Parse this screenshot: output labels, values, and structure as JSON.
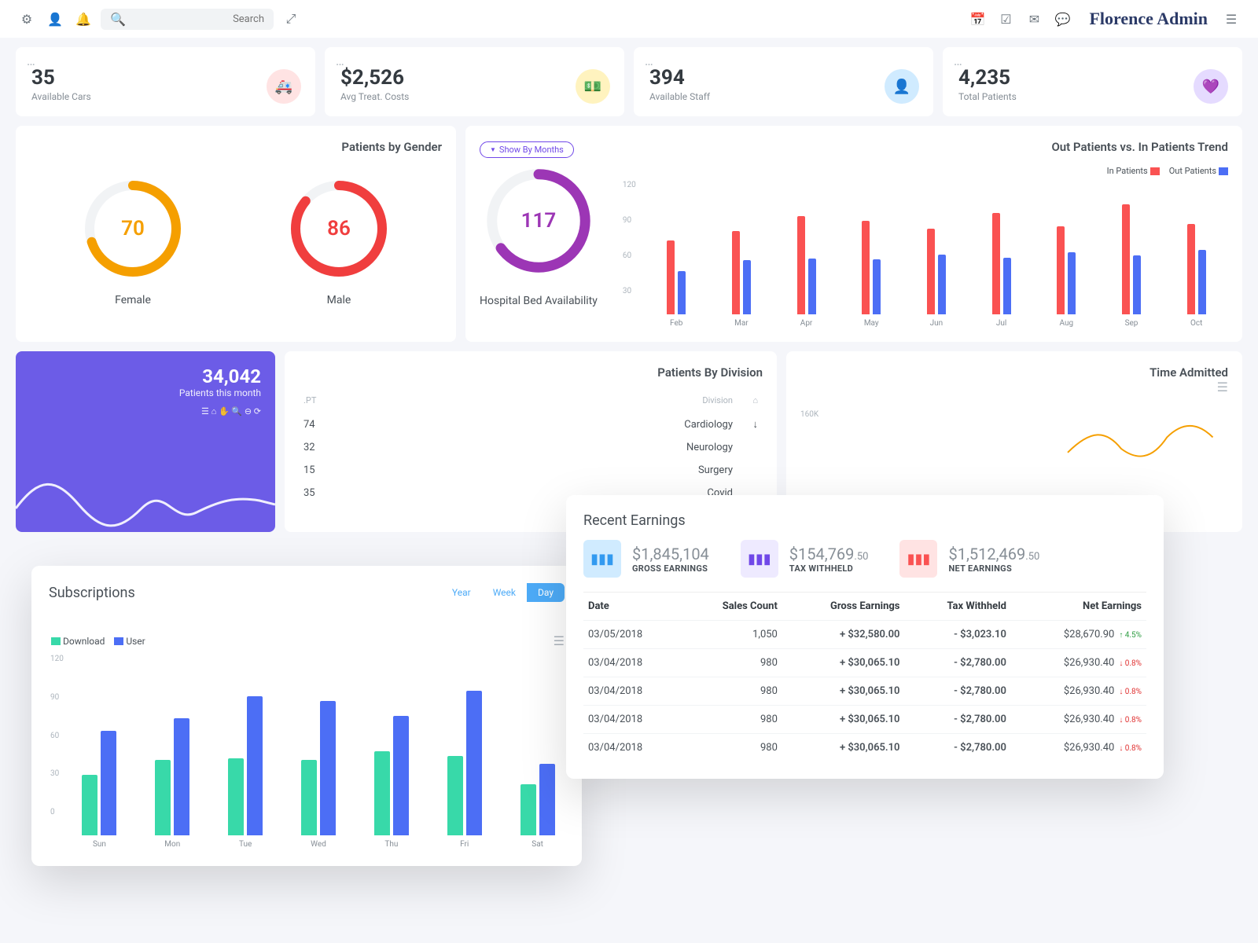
{
  "chart_data": [
    {
      "type": "bar",
      "title": "Out Patients vs. In Patients Trend",
      "categories": [
        "Feb",
        "Mar",
        "Apr",
        "May",
        "Jun",
        "Jul",
        "Aug",
        "Sep",
        "Oct"
      ],
      "series": [
        {
          "name": "In Patients",
          "color": "#fa5252",
          "values": [
            75,
            85,
            100,
            95,
            87,
            103,
            90,
            112,
            92
          ]
        },
        {
          "name": "Out Patients",
          "color": "#4c6ef5",
          "values": [
            44,
            55,
            57,
            56,
            61,
            58,
            63,
            60,
            66
          ]
        }
      ],
      "ylim": [
        0,
        120
      ],
      "yticks": [
        30,
        60,
        90,
        120
      ]
    },
    {
      "type": "bar",
      "title": "Subscriptions",
      "categories": [
        "Sun",
        "Mon",
        "Tue",
        "Wed",
        "Thu",
        "Fri",
        "Sat"
      ],
      "series": [
        {
          "name": "Download",
          "color": "#38d9a9",
          "values": [
            44,
            55,
            56,
            55,
            61,
            58,
            37
          ]
        },
        {
          "name": "User",
          "color": "#4c6ef5",
          "values": [
            76,
            85,
            101,
            98,
            87,
            105,
            52
          ]
        }
      ],
      "ylim": [
        0,
        120
      ],
      "yticks": [
        0,
        30,
        60,
        90,
        120
      ]
    }
  ],
  "topbar": {
    "search_placeholder": "Search",
    "brand": "Florence Admin"
  },
  "stats": [
    {
      "value": "35",
      "label": "Available Cars",
      "icon": "🚑",
      "bg": "#ffe3e3",
      "fg": "#fa5252"
    },
    {
      "value": "$2,526",
      "label": "Avg Treat. Costs",
      "icon": "💵",
      "bg": "#fff3bf",
      "fg": "#f59f00"
    },
    {
      "value": "394",
      "label": "Available Staff",
      "icon": "👤",
      "bg": "#d0ebff",
      "fg": "#228be6"
    },
    {
      "value": "4,235",
      "label": "Total Patients",
      "icon": "💜",
      "bg": "#e5dbff",
      "fg": "#7048e8"
    }
  ],
  "gender_card": {
    "title": "Patients by Gender",
    "female": {
      "label": "Female",
      "value": "70",
      "color": "#f59f00",
      "pct": 70
    },
    "male": {
      "label": "Male",
      "value": "86",
      "color": "#f03e3e",
      "pct": 86
    }
  },
  "beds_card": {
    "toggle_label": "Show By Months",
    "title": "Hospital Bed Availability",
    "value": "117",
    "color": "#9c36b5",
    "pct": 65
  },
  "trend_card": {
    "title": "Out Patients vs. In Patients Trend",
    "legend_in": "In Patients",
    "legend_out": "Out Patients"
  },
  "purple_card": {
    "big": "34,042",
    "sub": "Patients this month"
  },
  "division_card": {
    "title": "Patients By Division",
    "headers": {
      "pt": ".PT",
      "div": "Division",
      "home": "⌂"
    },
    "rows": [
      {
        "pt": "74",
        "name": "Cardiology",
        "icon": "↓"
      },
      {
        "pt": "32",
        "name": "Neurology",
        "icon": ""
      },
      {
        "pt": "15",
        "name": "Surgery",
        "icon": ""
      },
      {
        "pt": "35",
        "name": "Covid",
        "icon": ""
      }
    ]
  },
  "time_card": {
    "title": "Time Admitted",
    "ylabel": "160K"
  },
  "subs_card": {
    "title": "Subscriptions",
    "tabs": [
      "Year",
      "Week",
      "Day"
    ],
    "legend_dl": "Download",
    "legend_user": "User"
  },
  "earnings_card": {
    "title": "Recent Earnings",
    "summaries": [
      {
        "value": "$1,845,104",
        "decimal": "",
        "label": "GROSS EARNINGS",
        "bg": "#d0ebff",
        "fg": "#339af0"
      },
      {
        "value": "$154,769",
        "decimal": ".50",
        "label": "TAX WITHHELD",
        "bg": "#eeeaff",
        "fg": "#7048e8"
      },
      {
        "value": "$1,512,469",
        "decimal": ".50",
        "label": "NET EARNINGS",
        "bg": "#ffe3e3",
        "fg": "#fa5252"
      }
    ],
    "headers": [
      "Date",
      "Sales Count",
      "Gross Earnings",
      "Tax Withheld",
      "Net Earnings"
    ],
    "rows": [
      {
        "date": "03/05/2018",
        "count": "1,050",
        "gross": "+ $32,580.00",
        "tax": "- $3,023.10",
        "net": "$28,670.90",
        "badge": "↑ 4.5%",
        "dir": "up"
      },
      {
        "date": "03/04/2018",
        "count": "980",
        "gross": "+ $30,065.10",
        "tax": "- $2,780.00",
        "net": "$26,930.40",
        "badge": "↓ 0.8%",
        "dir": "dn"
      },
      {
        "date": "03/04/2018",
        "count": "980",
        "gross": "+ $30,065.10",
        "tax": "- $2,780.00",
        "net": "$26,930.40",
        "badge": "↓ 0.8%",
        "dir": "dn"
      },
      {
        "date": "03/04/2018",
        "count": "980",
        "gross": "+ $30,065.10",
        "tax": "- $2,780.00",
        "net": "$26,930.40",
        "badge": "↓ 0.8%",
        "dir": "dn"
      },
      {
        "date": "03/04/2018",
        "count": "980",
        "gross": "+ $30,065.10",
        "tax": "- $2,780.00",
        "net": "$26,930.40",
        "badge": "↓ 0.8%",
        "dir": "dn"
      }
    ]
  }
}
